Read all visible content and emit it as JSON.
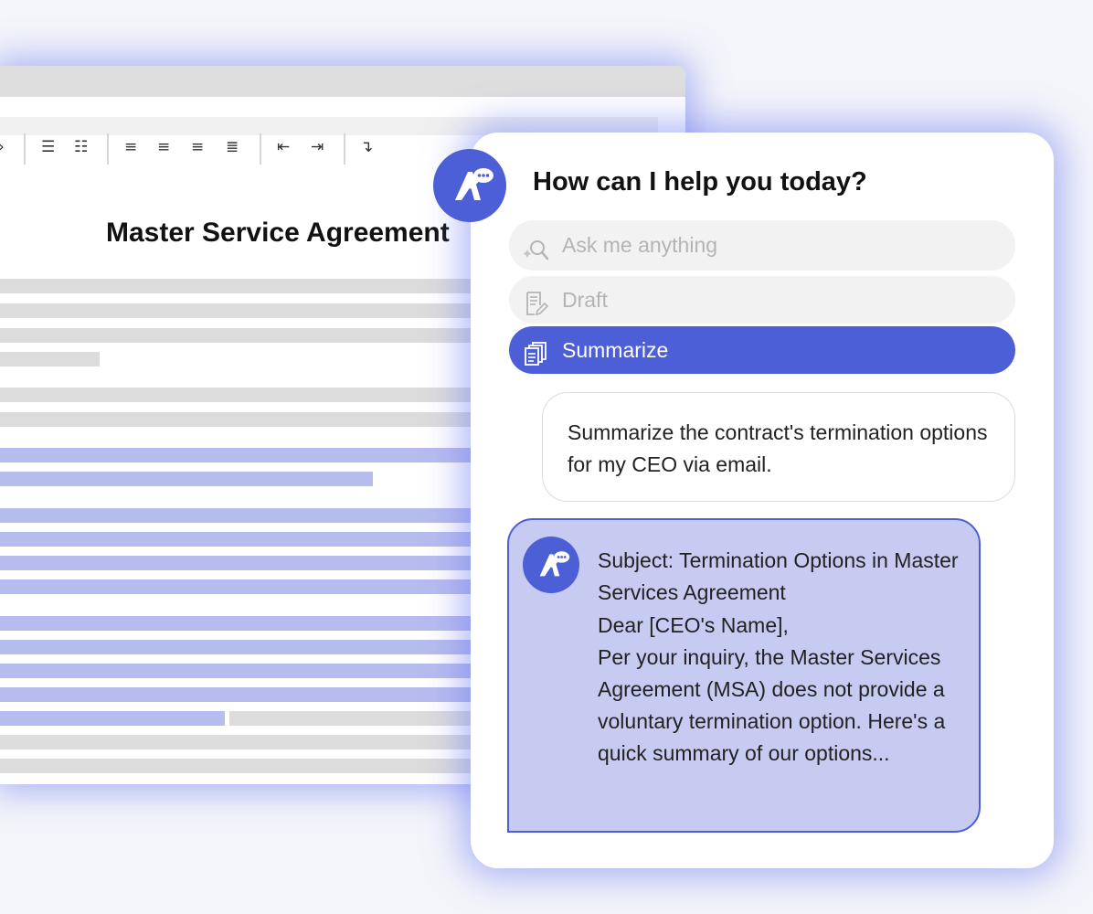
{
  "document": {
    "title": "Master Service Agreement",
    "toolbar": {
      "arrow_glyph": "›",
      "bullet_list_glyph": "☰",
      "numbered_list_glyph": "☷",
      "align_left_glyph": "≡",
      "align_center_glyph": "≡",
      "align_right_glyph": "≡",
      "justify_glyph": "≣",
      "outdent_glyph": "⇤",
      "indent_glyph": "⇥",
      "wrap_glyph": "↴"
    }
  },
  "assistant": {
    "heading": "How can I help you today?",
    "actions": {
      "ask": {
        "label": "Ask me anything",
        "icon": "search-sparkle-icon"
      },
      "draft": {
        "label": "Draft",
        "icon": "document-pen-icon"
      },
      "summarize": {
        "label": "Summarize",
        "icon": "documents-icon"
      }
    },
    "user_message": "Summarize the contract's termination options for my CEO via email.",
    "reply": {
      "subject": "Subject: Termination Options in Master Services Agreement",
      "greeting": "Dear [CEO's Name],",
      "body": "Per your inquiry, the Master Services Agreement (MSA) does not provide a voluntary termination option. Here's a quick summary of our options..."
    }
  },
  "colors": {
    "accent": "#4c5fd6",
    "reply_bg": "#c7cbf2",
    "highlight_line": "#b7bcee",
    "text_line": "#dcdcdc"
  }
}
